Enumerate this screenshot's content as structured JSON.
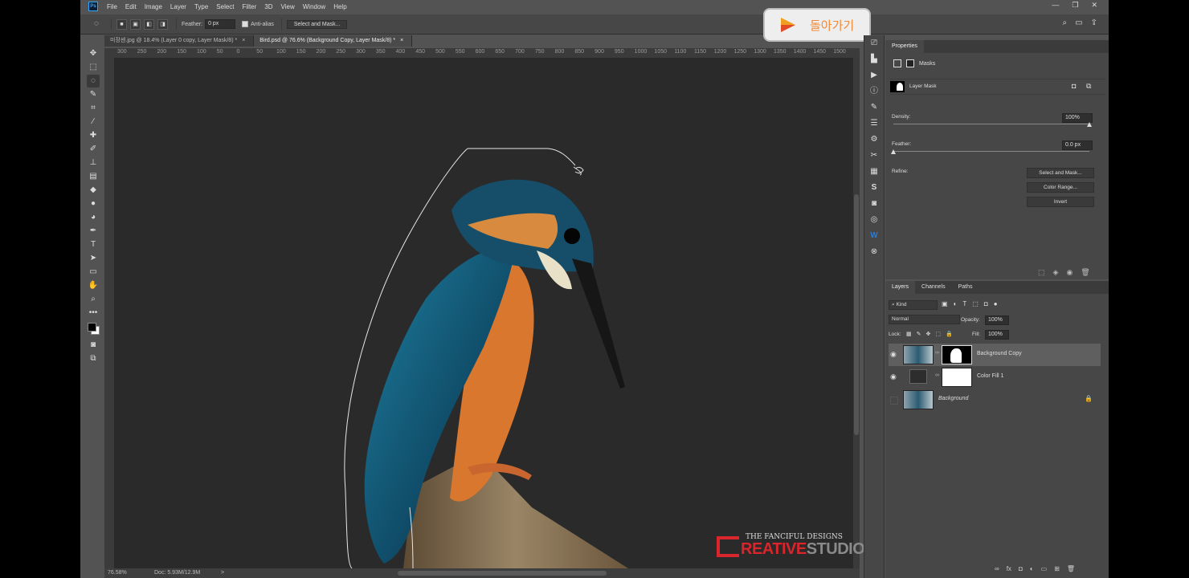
{
  "app": {
    "logo_text": "Ps"
  },
  "menu": [
    "File",
    "Edit",
    "Image",
    "Layer",
    "Type",
    "Select",
    "Filter",
    "3D",
    "View",
    "Window",
    "Help"
  ],
  "window_controls": [
    "—",
    "❐",
    "✕"
  ],
  "options_bar": {
    "feather_label": "Feather:",
    "feather_value": "0 px",
    "antialias_label": "Anti-alias",
    "select_mask_button": "Select and Mask..."
  },
  "tabs": [
    {
      "label": "미장센.jpg @ 18.4% (Layer 0 copy, Layer Mask/8) *",
      "close": "×"
    },
    {
      "label": "Bird.psd @ 76.6% (Background Copy, Layer Mask/8) *",
      "close": "×"
    }
  ],
  "ruler_ticks": [
    "300",
    "250",
    "200",
    "150",
    "100",
    "50",
    "0",
    "50",
    "100",
    "150",
    "200",
    "250",
    "300",
    "350",
    "400",
    "450",
    "500",
    "550",
    "600",
    "650",
    "700",
    "750",
    "800",
    "850",
    "900",
    "950",
    "1000",
    "1050",
    "1100",
    "1150",
    "1200",
    "1250",
    "1300",
    "1350",
    "1400",
    "1450",
    "1500"
  ],
  "status": {
    "zoom": "76.58%",
    "doc": "Doc: 5.93M/12.9M",
    "arrow": ">"
  },
  "overlay": {
    "back_label": "돌아가기"
  },
  "watermark": {
    "line1": "THE FANCIFUL DESIGNS",
    "creative": "REATIVE",
    "studio": "STUDIO",
    "c_letter": "C"
  },
  "properties": {
    "title": "Properties",
    "masks_label": "Masks",
    "layer_mask_label": "Layer Mask",
    "density_label": "Density:",
    "density_value": "100%",
    "density_level": 1.0,
    "feather_label": "Feather:",
    "feather_value": "0.0 px",
    "feather_level": 0.0,
    "refine_label": "Refine:",
    "buttons": [
      "Select and Mask...",
      "Color Range...",
      "Invert"
    ]
  },
  "layers_panel": {
    "tabs": [
      "Layers",
      "Channels",
      "Paths"
    ],
    "kind_label": "Kind",
    "blend_mode": "Normal",
    "opacity_label": "Opacity:",
    "opacity_value": "100%",
    "lock_label": "Lock:",
    "fill_label": "Fill:",
    "fill_value": "100%",
    "layers": [
      {
        "name": "Background Copy",
        "visible": true,
        "selected": true
      },
      {
        "name": "Color Fill 1",
        "visible": true,
        "selected": false
      },
      {
        "name": "Background",
        "visible": false,
        "selected": false,
        "locked": true
      }
    ]
  },
  "colors": {
    "accent_play": "#f0a020",
    "watermark_red": "#d9252b",
    "panel": "#474747",
    "canvas_bg": "#2a2a2a"
  }
}
